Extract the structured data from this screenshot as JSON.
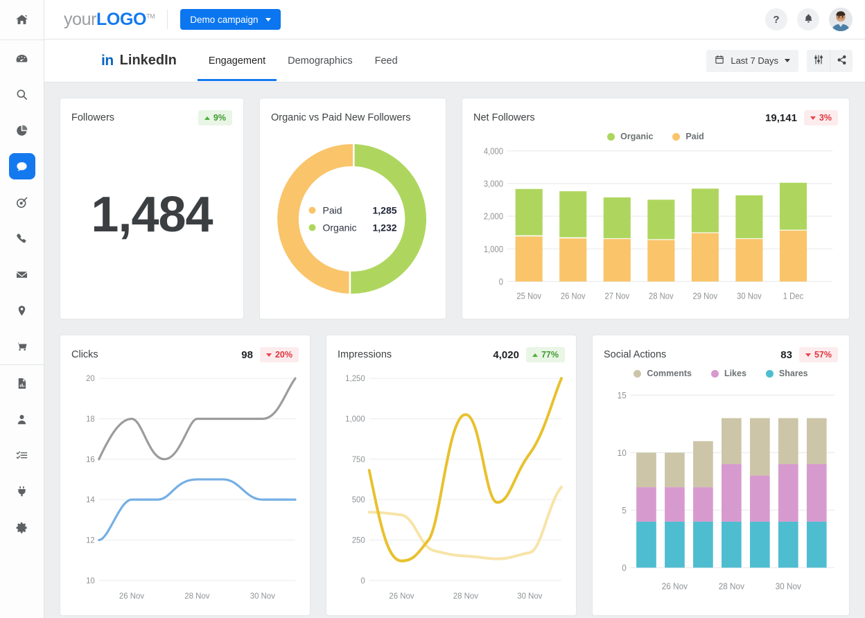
{
  "sidebar": {
    "items": [
      {
        "name": "home",
        "icon": "home-icon"
      },
      {
        "name": "dashboard",
        "icon": "gauge-icon"
      },
      {
        "name": "search",
        "icon": "search-icon"
      },
      {
        "name": "reports",
        "icon": "pie-chart-icon"
      },
      {
        "name": "messages",
        "icon": "chat-bubble-icon",
        "active": true
      },
      {
        "name": "targeting",
        "icon": "target-icon"
      },
      {
        "name": "calls",
        "icon": "phone-icon"
      },
      {
        "name": "email",
        "icon": "envelope-icon"
      },
      {
        "name": "locations",
        "icon": "map-pin-icon"
      },
      {
        "name": "commerce",
        "icon": "shopping-cart-icon"
      },
      {
        "name": "documents",
        "icon": "file-chart-icon"
      },
      {
        "name": "contacts",
        "icon": "person-icon"
      },
      {
        "name": "tasks",
        "icon": "checklist-icon"
      },
      {
        "name": "integrations",
        "icon": "plug-icon"
      },
      {
        "name": "settings",
        "icon": "gear-icon"
      }
    ]
  },
  "topbar": {
    "logo_pre": "your",
    "logo_bold": "LOGO",
    "logo_tm": "TM",
    "campaign_label": "Demo campaign",
    "help_label": "?",
    "notifications_icon": "bell-icon",
    "avatar_icon": "user-avatar"
  },
  "tabbar": {
    "network": "LinkedIn",
    "network_mark": "in",
    "tabs": [
      {
        "label": "Engagement",
        "active": true
      },
      {
        "label": "Demographics",
        "active": false
      },
      {
        "label": "Feed",
        "active": false
      }
    ],
    "date_range": "Last 7 Days",
    "calendar_icon": "calendar-icon",
    "filter_icon": "sliders-icon",
    "share_icon": "share-icon"
  },
  "colors": {
    "accent_blue": "#1479ef",
    "green": "#aed65e",
    "orange": "#f9c46a",
    "gray_line": "#9a9c9e",
    "blue_line": "#74aee4",
    "yellow_dark": "#e8c12e",
    "yellow_light": "#f7e4a8",
    "tan": "#ccc5a8",
    "pink": "#d79ace",
    "teal": "#4fbdd0",
    "up_green": "#3f9a31",
    "down_red": "#e0363f"
  },
  "cards": {
    "followers": {
      "title": "Followers",
      "value": "1,484",
      "delta": "9%",
      "delta_dir": "up"
    },
    "organic_vs_paid": {
      "title": "Organic vs Paid New Followers",
      "legend": [
        {
          "label": "Paid",
          "value": "1,285",
          "color": "#f9c46a"
        },
        {
          "label": "Organic",
          "value": "1,232",
          "color": "#aed65e"
        }
      ]
    },
    "net_followers": {
      "title": "Net Followers",
      "value": "19,141",
      "delta": "3%",
      "delta_dir": "down"
    },
    "clicks": {
      "title": "Clicks",
      "value": "98",
      "delta": "20%",
      "delta_dir": "down"
    },
    "impressions": {
      "title": "Impressions",
      "value": "4,020",
      "delta": "77%",
      "delta_dir": "up"
    },
    "social_actions": {
      "title": "Social Actions",
      "value": "83",
      "delta": "57%",
      "delta_dir": "down"
    }
  },
  "chart_data": [
    {
      "id": "organic_vs_paid_donut",
      "type": "pie",
      "title": "Organic vs Paid New Followers",
      "labels": [
        "Paid",
        "Organic"
      ],
      "values": [
        1285,
        1232
      ],
      "colors": [
        "#f9c46a",
        "#aed65e"
      ],
      "legend_position": "center"
    },
    {
      "id": "net_followers_bars",
      "type": "bar",
      "title": "Net Followers",
      "stacked": true,
      "categories": [
        "25 Nov",
        "26 Nov",
        "27 Nov",
        "28 Nov",
        "29 Nov",
        "30 Nov",
        "1 Dec"
      ],
      "series": [
        {
          "name": "Paid",
          "color": "#f9c46a",
          "values": [
            1380,
            1320,
            1300,
            1270,
            1480,
            1300,
            1560
          ]
        },
        {
          "name": "Organic",
          "color": "#aed65e",
          "values": [
            1420,
            1410,
            1250,
            1210,
            1340,
            1340,
            1440
          ]
        }
      ],
      "yticks": [
        "0",
        "1,000",
        "2,000",
        "3,000",
        "4,000"
      ],
      "ylim": [
        0,
        4000
      ],
      "grid": true,
      "legend_position": "top-center"
    },
    {
      "id": "clicks_lines",
      "type": "line",
      "title": "Clicks",
      "x": [
        "25 Nov",
        "26 Nov",
        "27 Nov",
        "28 Nov",
        "29 Nov",
        "30 Nov",
        "1 Dec"
      ],
      "xticks": [
        "26 Nov",
        "28 Nov",
        "30 Nov"
      ],
      "series": [
        {
          "name": "Series A",
          "color": "#9a9c9e",
          "values": [
            16,
            18,
            16,
            18,
            18,
            18,
            19
          ]
        },
        {
          "name": "Series B",
          "color": "#74aee4",
          "values": [
            12,
            14,
            14,
            15,
            15,
            14,
            14
          ]
        }
      ],
      "yticks": [
        "10",
        "12",
        "14",
        "16",
        "18",
        "20"
      ],
      "ylim": [
        10,
        20
      ],
      "grid": true
    },
    {
      "id": "impressions_lines",
      "type": "line",
      "title": "Impressions",
      "x": [
        "25 Nov",
        "26 Nov",
        "27 Nov",
        "28 Nov",
        "29 Nov",
        "30 Nov",
        "1 Dec"
      ],
      "xticks": [
        "26 Nov",
        "28 Nov",
        "30 Nov"
      ],
      "series": [
        {
          "name": "Series A",
          "color": "#e8c12e",
          "values": [
            680,
            120,
            200,
            780,
            480,
            700,
            1000
          ]
        },
        {
          "name": "Series B",
          "color": "#f7e4a8",
          "values": [
            420,
            400,
            210,
            180,
            160,
            190,
            700
          ]
        }
      ],
      "yticks": [
        "0",
        "250",
        "500",
        "750",
        "1,000",
        "1,250"
      ],
      "ylim": [
        0,
        1250
      ],
      "grid": true
    },
    {
      "id": "social_actions_bars",
      "type": "bar",
      "title": "Social Actions",
      "stacked": true,
      "categories": [
        "25 Nov",
        "26 Nov",
        "27 Nov",
        "28 Nov",
        "29 Nov",
        "30 Nov",
        "1 Dec"
      ],
      "xticks": [
        "26 Nov",
        "28 Nov",
        "30 Nov"
      ],
      "series": [
        {
          "name": "Shares",
          "color": "#4fbdd0",
          "values": [
            4,
            4,
            4,
            4,
            4,
            4,
            4
          ]
        },
        {
          "name": "Likes",
          "color": "#d79ace",
          "values": [
            3,
            3,
            3,
            5,
            4,
            5,
            5
          ]
        },
        {
          "name": "Comments",
          "color": "#ccc5a8",
          "values": [
            3,
            3,
            4,
            4,
            5,
            4,
            4
          ]
        }
      ],
      "yticks": [
        "0",
        "5",
        "10",
        "15"
      ],
      "ylim": [
        0,
        15
      ],
      "grid": true,
      "legend_position": "top-center"
    }
  ]
}
